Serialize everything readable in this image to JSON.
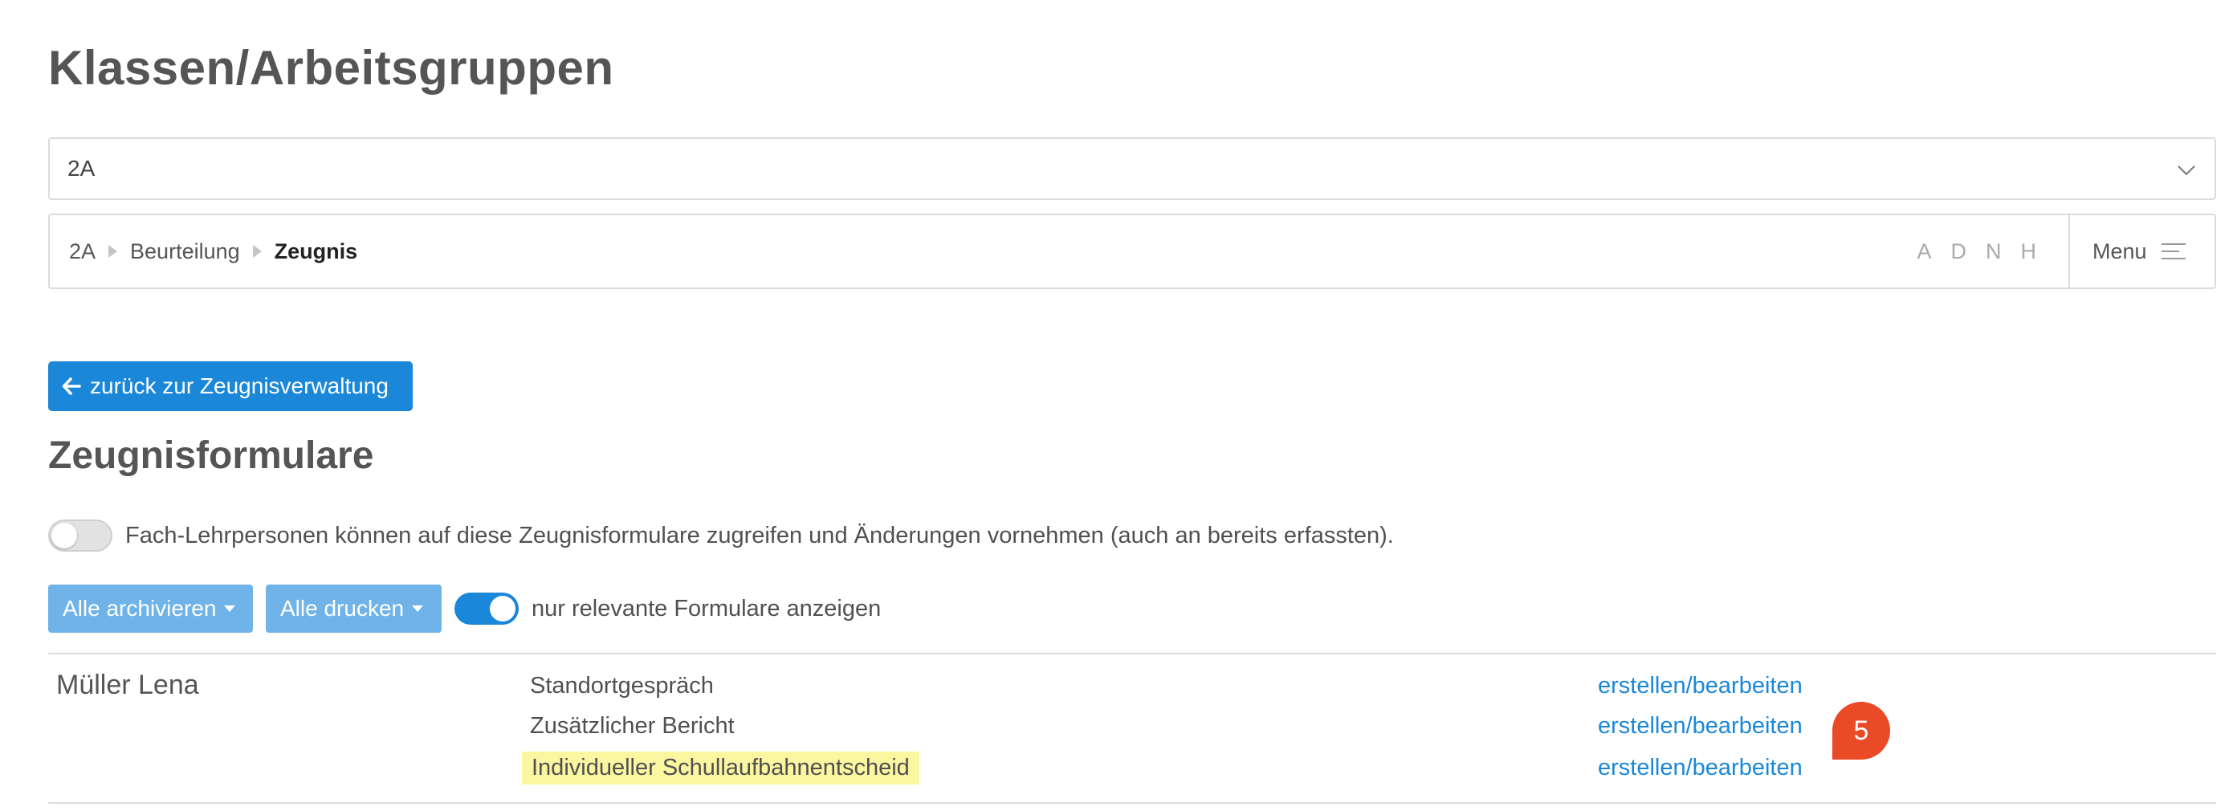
{
  "page": {
    "title": "Klassen/Arbeitsgruppen"
  },
  "class_select": {
    "value": "2A"
  },
  "breadcrumb": {
    "items": [
      "2A",
      "Beurteilung",
      "Zeugnis"
    ]
  },
  "letter_nav": [
    "A",
    "D",
    "N",
    "H"
  ],
  "menu": {
    "label": "Menu"
  },
  "back_button": {
    "label": "zurück zur Zeugnisverwaltung"
  },
  "section": {
    "title": "Zeugnisformulare"
  },
  "permission": {
    "label": "Fach-Lehrpersonen können auf diese Zeugnisformulare zugreifen und Änderungen vornehmen (auch an bereits erfassten).",
    "enabled": false
  },
  "actions": {
    "archive_all": "Alle archivieren",
    "print_all": "Alle drucken",
    "relevant_toggle_label": "nur relevante Formulare anzeigen",
    "relevant_enabled": true
  },
  "students": [
    {
      "name": "Müller Lena",
      "forms": [
        {
          "name": "Standortgespräch",
          "action": "erstellen/bearbeiten"
        },
        {
          "name": "Zusätzlicher Bericht",
          "action": "erstellen/bearbeiten"
        },
        {
          "name": "Individueller Schullaufbahnentscheid",
          "action": "erstellen/bearbeiten"
        }
      ]
    }
  ],
  "notification_badge": {
    "count": "5"
  },
  "colors": {
    "primary": "#1b87d8",
    "button_light": "#6fb3e8",
    "highlight": "#fbf6a0",
    "badge": "#ea4a26"
  }
}
